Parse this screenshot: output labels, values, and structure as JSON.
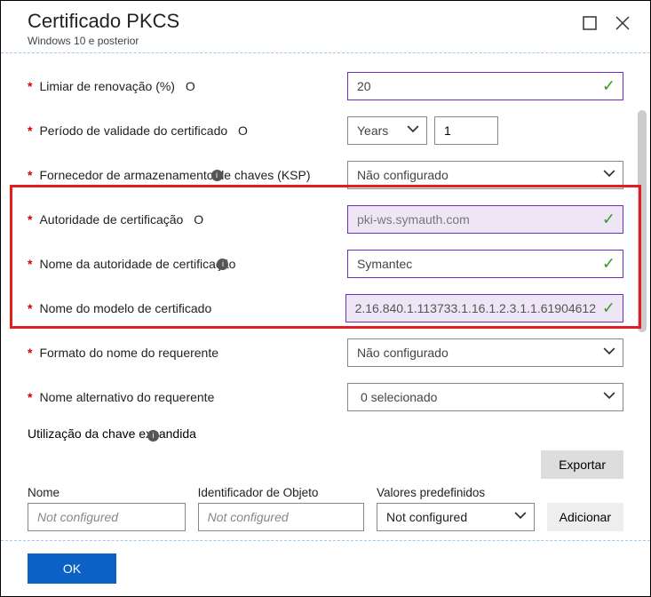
{
  "header": {
    "title": "Certificado PKCS",
    "subtitle": "Windows 10 e posterior"
  },
  "fields": {
    "renewal": {
      "label": "Limiar de renovação (%)",
      "value": "20"
    },
    "validity": {
      "label": "Período de validade do certificado",
      "unit": "Years",
      "value": "1"
    },
    "ksp": {
      "label": "Fornecedor de armazenamento de chaves (KSP)",
      "value": "Não configurado"
    },
    "ca": {
      "label": "Autoridade de certificação",
      "value": "pki-ws.symauth.com"
    },
    "ca_name": {
      "label": "Nome da autoridade de certificação",
      "value": "Symantec"
    },
    "template": {
      "label": "Nome do modelo de certificado",
      "value": "2.16.840.1.113733.1.16.1.2.3.1.1.61904612"
    },
    "subject_fmt": {
      "label": "Formato do nome do requerente",
      "value": "Não configurado"
    },
    "san": {
      "label": "Nome alternativo do requerente",
      "value": "0 selecionado"
    }
  },
  "eku": {
    "title": "Utilização da chave expandida",
    "export": "Exportar",
    "cols": {
      "name": "Nome",
      "oid": "Identificador de Objeto",
      "preset": "Valores predefinidos"
    },
    "placeholder": "Not configured",
    "preset_value": "Not configured",
    "add": "Adicionar"
  },
  "footer": {
    "ok": "OK"
  },
  "hint": "O",
  "info": "i"
}
